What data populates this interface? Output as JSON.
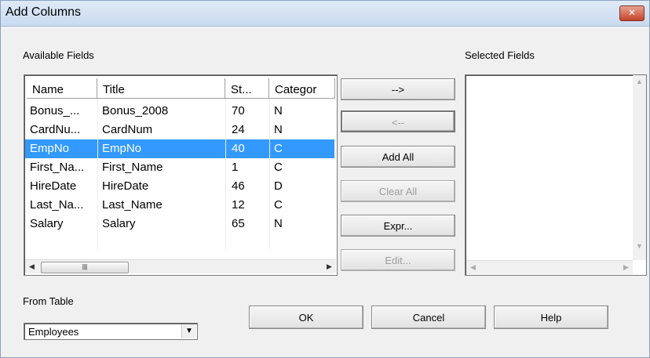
{
  "window": {
    "title": "Add Columns",
    "close_glyph": "✕"
  },
  "available": {
    "label": "Available Fields",
    "columns": [
      "Name",
      "Title",
      "St...",
      "Categor"
    ],
    "rows": [
      [
        "Bonus_...",
        "Bonus_2008",
        "70",
        "N"
      ],
      [
        "CardNu...",
        "CardNum",
        "24",
        "N"
      ],
      [
        "EmpNo",
        "EmpNo",
        "40",
        "C"
      ],
      [
        "First_Na...",
        "First_Name",
        "1",
        "C"
      ],
      [
        "HireDate",
        "HireDate",
        "46",
        "D"
      ],
      [
        "Last_Na...",
        "Last_Name",
        "12",
        "C"
      ],
      [
        "Salary",
        "Salary",
        "65",
        "N"
      ]
    ],
    "selected_row": "EmpNo",
    "hscroll_thumb_glyph": "|||"
  },
  "selected": {
    "label": "Selected Fields"
  },
  "buttons": {
    "add": "-->",
    "remove": "<--",
    "add_all": "Add All",
    "clear_all": "Clear All",
    "expr": "Expr...",
    "edit": "Edit...",
    "ok": "OK",
    "cancel": "Cancel",
    "help": "Help"
  },
  "from_table": {
    "label": "From Table",
    "value": "Employees"
  },
  "colors": {
    "selection": "#3399ff",
    "disabled_text": "#9d9d9d"
  }
}
